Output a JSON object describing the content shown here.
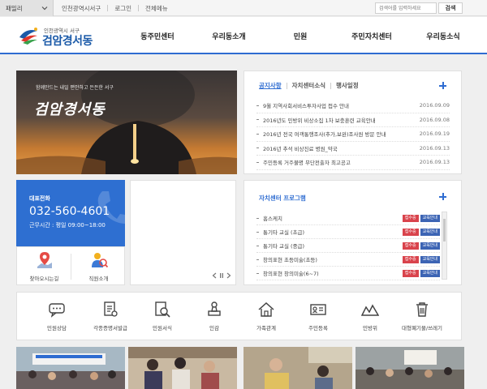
{
  "topbar": {
    "family_label": "패밀리",
    "links": [
      "인천광역시서구",
      "로그인",
      "전체메뉴"
    ],
    "search_placeholder": "검색어를 입력하세요",
    "search_button": "검색"
  },
  "header": {
    "logo_sub": "인천광역시 서구",
    "logo_main": "검암경서동",
    "nav": [
      "동주민센터",
      "우리동소개",
      "민원",
      "주민자치센터",
      "우리동소식"
    ]
  },
  "hero": {
    "tagline": "함께만드는 내일 편안하고 든든한 서구",
    "title": "검암경서동"
  },
  "notice": {
    "tabs": [
      "공지사항",
      "자치센터소식",
      "행사일정"
    ],
    "items": [
      {
        "title": "9월 지역사회서비스투자사업 접수 안내",
        "date": "2016.09.09"
      },
      {
        "title": "2016년도 민방위 비상소집 1차 보충훈련 교육안내",
        "date": "2016.09.08"
      },
      {
        "title": "2016년 전국 여객통행조사(추가,보완)조사원 방문 안내",
        "date": "2016.09.19"
      },
      {
        "title": "2016년 추석 비상진료 병원_약국",
        "date": "2016.09.13"
      },
      {
        "title": "주민등록 거주불명 무단전출자 최고공고",
        "date": "2016.09.13"
      }
    ]
  },
  "contact": {
    "label": "대표전화",
    "phone": "032-560-4601",
    "hours": "근무시간 : 평일 09:00~18:00"
  },
  "quick": [
    {
      "label": "찾아오시는길",
      "icon": "map-pin-icon"
    },
    {
      "label": "직원소개",
      "icon": "staff-icon"
    }
  ],
  "program": {
    "title": "자치센터 프로그램",
    "status_badge": "접수중",
    "category_badge": "교육안내",
    "items": [
      "홈스케치",
      "통기타 교실 (초급)",
      "통기타 교실 (중급)",
      "창의표현 초등미술(초등)",
      "창의표현 창의미술(6~7)"
    ]
  },
  "menu": [
    {
      "label": "민원상담",
      "icon": "chat-icon"
    },
    {
      "label": "각종증명서발급",
      "icon": "certificate-icon"
    },
    {
      "label": "민원서식",
      "icon": "form-search-icon"
    },
    {
      "label": "인감",
      "icon": "seal-icon"
    },
    {
      "label": "가족관계",
      "icon": "house-icon"
    },
    {
      "label": "주민등록",
      "icon": "id-card-icon"
    },
    {
      "label": "민방위",
      "icon": "mountain-icon"
    },
    {
      "label": "대형폐기물/쓰레기",
      "icon": "trash-icon"
    }
  ],
  "colors": {
    "accent": "#2e6cd1",
    "badge_red": "#d9434c",
    "badge_blue": "#3c64b4"
  }
}
